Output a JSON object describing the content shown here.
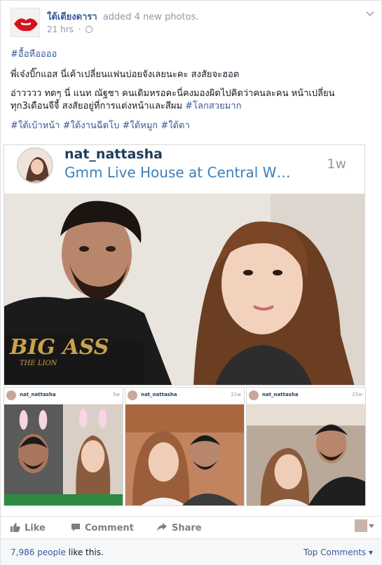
{
  "post": {
    "page_name": "ใต้เตียงดารา",
    "action_text": "added 4 new photos.",
    "time": "21 hrs",
    "hashtag_top": "#อื้อหืออออ",
    "line1": "พี่เจ๋งบิ๊กแอส นี่เค้าเปลี่ยนแฟนบ่อยจังเลยนะคะ สงสัยจะฮอต",
    "line2": "อ่าวววว ทดๆ นี่ แนท ณัฐชา คนเดิมหรอคะนี่คงมองผิดไปคิดว่าคนละคน หน้าเปลี่ยน",
    "line3_text": "ทุก3เดือนจีจี้ สงสัยอยู่ที่การแต่งหน้าและสีผม ",
    "line3_tag": "#โลกสวยมาก",
    "tags": [
      "#ใต้เบ้าหน้า",
      "#ใต้งานฉีดโบ",
      "#ใต้หมูก",
      "#ใต้ตา"
    ]
  },
  "embed": {
    "username": "nat_nattasha",
    "location": "Gmm Live House at Central W…",
    "time": "1w",
    "shirt_text": "BIG ASS",
    "shirt_sub": "THE LION"
  },
  "thumbs": [
    {
      "username": "nat_nattasha",
      "time": "5w"
    },
    {
      "username": "nat_nattasha",
      "time": "21w"
    },
    {
      "username": "nat_nattasha",
      "time": "25w"
    }
  ],
  "actions": {
    "like": "Like",
    "comment": "Comment",
    "share": "Share"
  },
  "footer": {
    "likes_count": "7,986 people",
    "likes_rest": " like this.",
    "top_comments": "Top Comments ▾"
  },
  "colors": {
    "link": "#3b5998",
    "muted": "#9197a3",
    "ig_blue": "#3b7fbd"
  }
}
